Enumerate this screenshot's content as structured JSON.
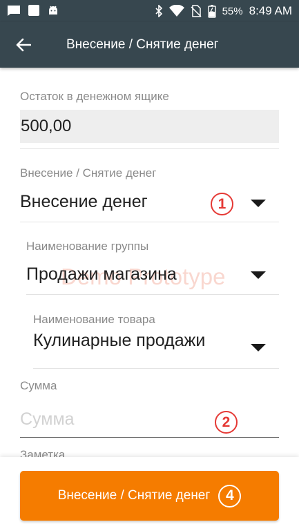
{
  "status_bar": {
    "battery": "55%",
    "time": "8:49 AM",
    "left_icons": [
      "message-icon",
      "square-icon",
      "android-icon"
    ],
    "right_icons": [
      "bluetooth-icon",
      "wifi-icon",
      "no-sim-icon",
      "battery-charging-icon"
    ]
  },
  "app_bar": {
    "title": "Внесение / Снятие денег",
    "back_icon": "arrow-left-icon"
  },
  "form": {
    "balance_label": "Остаток в денежном ящике",
    "balance_value": "500,00",
    "operation_label": "Внесение / Снятие денег",
    "operation_value": "Внесение денег",
    "group_label": "Наименование группы",
    "group_value": "Продажи магазина",
    "product_label": "Наименование товара",
    "product_value": "Кулинарные продажи",
    "sum_label": "Сумма",
    "sum_placeholder": "Сумма",
    "note_label": "Заметка"
  },
  "annotations": {
    "one": "1",
    "two": "2",
    "four": "4"
  },
  "watermark": "Demo Prototype",
  "submit_label": "Внесение / Снятие денег",
  "colors": {
    "app_bar": "#37474f",
    "accent": "#f57c00",
    "annotation": "#e53935"
  }
}
